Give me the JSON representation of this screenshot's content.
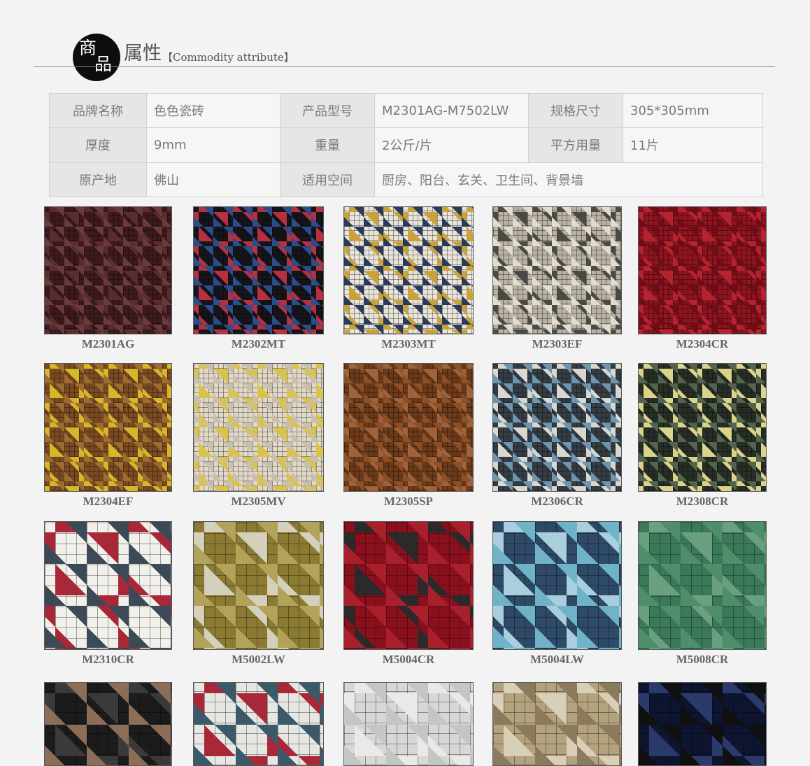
{
  "header": {
    "badge_top": "商",
    "badge_bottom": "品",
    "title": "属性",
    "subtitle": "【Commodity attribute】"
  },
  "attributes": [
    [
      {
        "label": "品牌名称",
        "value": "色色瓷砖"
      },
      {
        "label": "产品型号",
        "value": "M2301AG-M7502LW"
      },
      {
        "label": "规格尺寸",
        "value": "305*305mm"
      }
    ],
    [
      {
        "label": "厚度",
        "value": "9mm"
      },
      {
        "label": "重量",
        "value": "2公斤/片"
      },
      {
        "label": "平方用量",
        "value": "11片"
      }
    ],
    [
      {
        "label": "原产地",
        "value": "佛山"
      },
      {
        "label": "适用空间",
        "value": "厨房、阳台、玄关、卫生间、背景墙"
      }
    ]
  ],
  "products": [
    {
      "code": "M2301AG",
      "colors": [
        "#3d1a1e",
        "#6a3a3c",
        "#5a2c30"
      ]
    },
    {
      "code": "M2302MT",
      "colors": [
        "#15161c",
        "#2d4d8a",
        "#b83040"
      ]
    },
    {
      "code": "M2303MT",
      "colors": [
        "#e8e4da",
        "#2a3a5a",
        "#c9a23a"
      ]
    },
    {
      "code": "M2303EF",
      "colors": [
        "#b9b1a2",
        "#e1dccf",
        "#4a4a45"
      ]
    },
    {
      "code": "M2304CR",
      "colors": [
        "#8e1420",
        "#6d0d16",
        "#b42430"
      ]
    },
    {
      "code": "M2304EF",
      "colors": [
        "#7a4a22",
        "#a06a30",
        "#d4b82a"
      ]
    },
    {
      "code": "M2305MV",
      "colors": [
        "#e1d8c8",
        "#c9bfae",
        "#d9c34a"
      ]
    },
    {
      "code": "M2305SP",
      "colors": [
        "#6b3a1a",
        "#8c5028",
        "#a0623a"
      ]
    },
    {
      "code": "M2306CR",
      "colors": [
        "#343c44",
        "#6f94ad",
        "#d8d8d0"
      ]
    },
    {
      "code": "M2308CR",
      "colors": [
        "#262e26",
        "#53634e",
        "#d9d48a"
      ]
    },
    {
      "code": "M2310CR",
      "colors": [
        "#f2f0ea",
        "#3c4a58",
        "#a82838"
      ]
    },
    {
      "code": "M5002LW",
      "colors": [
        "#8a7a32",
        "#b3a35a",
        "#d5d0bc"
      ]
    },
    {
      "code": "M5004CR",
      "colors": [
        "#8a101e",
        "#a8202c",
        "#2a2a2a"
      ]
    },
    {
      "code": "M5004LW",
      "colors": [
        "#2e4a66",
        "#6fb3c9",
        "#a9cfde"
      ]
    },
    {
      "code": "M5008CR",
      "colors": [
        "#3a7a5a",
        "#4f8e6b",
        "#6aa07f"
      ]
    },
    {
      "code": "",
      "colors": [
        "#1c1c1c",
        "#8c6d58",
        "#3a3a3a"
      ]
    },
    {
      "code": "",
      "colors": [
        "#e6e6e2",
        "#3a5a6a",
        "#a82838"
      ]
    },
    {
      "code": "",
      "colors": [
        "#d7d8d5",
        "#c3c6c2",
        "#e9eae8"
      ]
    },
    {
      "code": "",
      "colors": [
        "#b3a27e",
        "#8c7a5c",
        "#d8cfb8"
      ]
    },
    {
      "code": "",
      "colors": [
        "#0e1530",
        "#101010",
        "#2a3a6a"
      ]
    }
  ]
}
